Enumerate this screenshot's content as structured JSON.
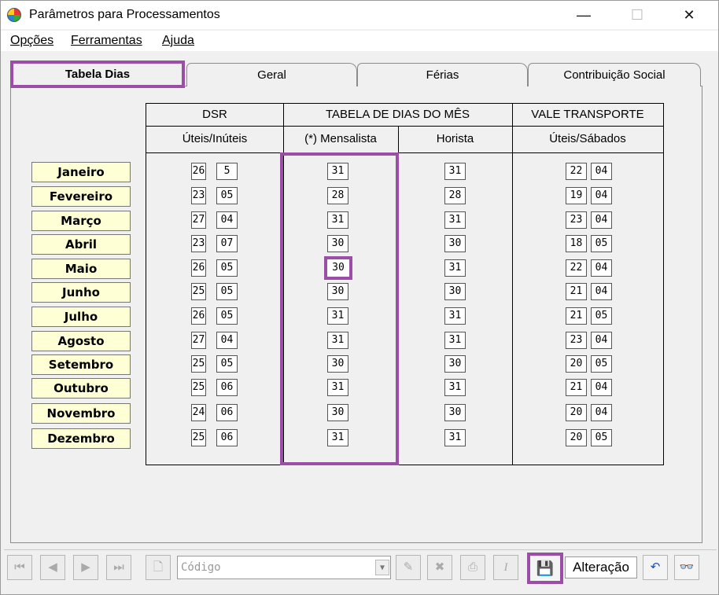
{
  "window": {
    "title": "Parâmetros para Processamentos",
    "minimize": "—",
    "maximize": "☐",
    "close": "✕"
  },
  "menu": {
    "items": [
      {
        "label": "Opções"
      },
      {
        "label": "Ferramentas"
      },
      {
        "label": "Ajuda"
      }
    ]
  },
  "tabs": [
    {
      "label": "Tabela Dias",
      "active": true
    },
    {
      "label": "Geral"
    },
    {
      "label": "Férias"
    },
    {
      "label": "Contribuição Social"
    }
  ],
  "table": {
    "headers": {
      "dsr": "DSR",
      "tabela_dias": "TABELA DE DIAS DO MÊS",
      "vale_transporte": "VALE TRANSPORTE",
      "uteis_inuteis": "Úteis/Inúteis",
      "mensalista": "(*) Mensalista",
      "horista": "Horista",
      "uteis_sabados": "Úteis/Sábados"
    },
    "rows": [
      {
        "month": "Janeiro",
        "dsr_uteis": "26",
        "dsr_inuteis": "5",
        "mensalista": "31",
        "horista": "31",
        "vt_uteis": "22",
        "vt_sabados": "04"
      },
      {
        "month": "Fevereiro",
        "dsr_uteis": "23",
        "dsr_inuteis": "05",
        "mensalista": "28",
        "horista": "28",
        "vt_uteis": "19",
        "vt_sabados": "04"
      },
      {
        "month": "Março",
        "dsr_uteis": "27",
        "dsr_inuteis": "04",
        "mensalista": "31",
        "horista": "31",
        "vt_uteis": "23",
        "vt_sabados": "04"
      },
      {
        "month": "Abril",
        "dsr_uteis": "23",
        "dsr_inuteis": "07",
        "mensalista": "30",
        "horista": "30",
        "vt_uteis": "18",
        "vt_sabados": "05"
      },
      {
        "month": "Maio",
        "dsr_uteis": "26",
        "dsr_inuteis": "05",
        "mensalista": "30",
        "horista": "31",
        "vt_uteis": "22",
        "vt_sabados": "04"
      },
      {
        "month": "Junho",
        "dsr_uteis": "25",
        "dsr_inuteis": "05",
        "mensalista": "30",
        "horista": "30",
        "vt_uteis": "21",
        "vt_sabados": "04"
      },
      {
        "month": "Julho",
        "dsr_uteis": "26",
        "dsr_inuteis": "05",
        "mensalista": "31",
        "horista": "31",
        "vt_uteis": "21",
        "vt_sabados": "05"
      },
      {
        "month": "Agosto",
        "dsr_uteis": "27",
        "dsr_inuteis": "04",
        "mensalista": "31",
        "horista": "31",
        "vt_uteis": "23",
        "vt_sabados": "04"
      },
      {
        "month": "Setembro",
        "dsr_uteis": "25",
        "dsr_inuteis": "05",
        "mensalista": "30",
        "horista": "30",
        "vt_uteis": "20",
        "vt_sabados": "05"
      },
      {
        "month": "Outubro",
        "dsr_uteis": "25",
        "dsr_inuteis": "06",
        "mensalista": "31",
        "horista": "31",
        "vt_uteis": "21",
        "vt_sabados": "04"
      },
      {
        "month": "Novembro",
        "dsr_uteis": "24",
        "dsr_inuteis": "06",
        "mensalista": "30",
        "horista": "30",
        "vt_uteis": "20",
        "vt_sabados": "04"
      },
      {
        "month": "Dezembro",
        "dsr_uteis": "25",
        "dsr_inuteis": "06",
        "mensalista": "31",
        "horista": "31",
        "vt_uteis": "20",
        "vt_sabados": "05"
      }
    ]
  },
  "toolbar": {
    "codigo_placeholder": "Código",
    "status": "Alteração",
    "icons": [
      "first-icon",
      "prev-icon",
      "next-icon",
      "last-icon",
      "new-document-icon",
      "document-edit-icon",
      "delete-icon",
      "print-icon",
      "italic-icon",
      "save-icon",
      "undo-icon",
      "binoculars-icon"
    ]
  },
  "colors": {
    "highlight": "#9b4ea6",
    "month_label_bg": "#ffffd6",
    "panel_bg": "#f0f0f0"
  }
}
